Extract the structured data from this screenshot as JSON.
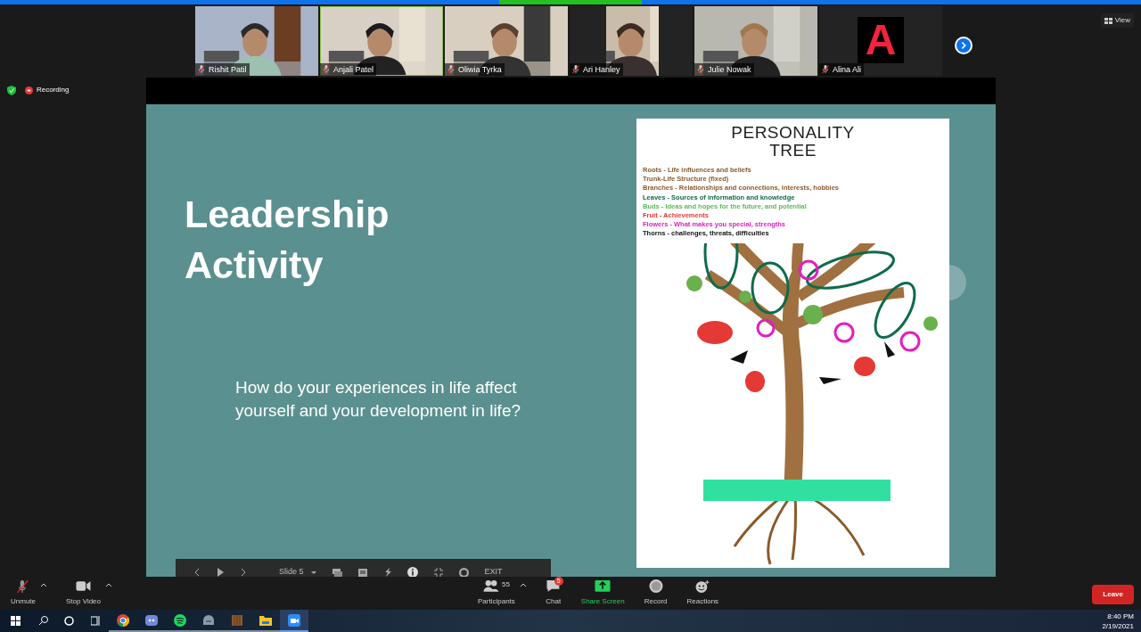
{
  "participants": [
    {
      "name": "Rishit Patil",
      "kind": "video",
      "muted": true,
      "speaking": false
    },
    {
      "name": "Anjali Patel",
      "kind": "video",
      "muted": true,
      "speaking": true
    },
    {
      "name": "Oliwia Tyrka",
      "kind": "video",
      "muted": true,
      "speaking": false
    },
    {
      "name": "Ari Hanley",
      "kind": "narrow",
      "muted": true,
      "speaking": false
    },
    {
      "name": "Julie Nowak",
      "kind": "video",
      "muted": true,
      "speaking": false
    },
    {
      "name": "Alina Ali",
      "kind": "avatar",
      "muted": true,
      "speaking": false,
      "letter": "A"
    }
  ],
  "view_button": "View",
  "recording": "Recording",
  "slide": {
    "title": "Leadership Activity",
    "question": "How do your experiences in life affect yourself and your development in life?",
    "poster_title": [
      "PERSONALITY",
      "TREE"
    ],
    "legend": [
      {
        "text": "Roots - Life influences and beliefs",
        "color": "#8a5a2b"
      },
      {
        "text": "Trunk-Life Structure (fixed)",
        "color": "#8a5a2b"
      },
      {
        "text": "Branches - Relationships and connections, interests, hobbies",
        "color": "#8a5a2b"
      },
      {
        "text": "Leaves - Sources of information and knowledge",
        "color": "#0f6b4a"
      },
      {
        "text": "Buds - Ideas and hopes for the future, and potential",
        "color": "#5cb85c"
      },
      {
        "text": "Fruit - Achievements",
        "color": "#e53935"
      },
      {
        "text": "Flowers - What makes you special, strengths",
        "color": "#e020c0"
      },
      {
        "text": "Thorns - challenges, threats, difficulties",
        "color": "#111111"
      }
    ],
    "toolbar": {
      "slide_label": "Slide 5",
      "exit": "EXIT"
    }
  },
  "controls": [
    {
      "label": "Unmute",
      "kind": "mic"
    },
    {
      "label": "Stop Video",
      "kind": "video"
    }
  ],
  "center_controls": [
    {
      "label": "Participants",
      "kind": "participants",
      "count": "55"
    },
    {
      "label": "Chat",
      "kind": "chat",
      "badge": "5"
    },
    {
      "label": "Share Screen",
      "kind": "share"
    },
    {
      "label": "Record",
      "kind": "record"
    },
    {
      "label": "Reactions",
      "kind": "reactions"
    }
  ],
  "leave": "Leave",
  "taskbar": {
    "apps": [
      {
        "kind": "chrome",
        "selected": false
      },
      {
        "kind": "discord",
        "selected": false
      },
      {
        "kind": "spotify",
        "selected": false
      },
      {
        "kind": "steam",
        "selected": false
      },
      {
        "kind": "crate",
        "selected": false
      },
      {
        "kind": "folder",
        "selected": false
      },
      {
        "kind": "zoom",
        "selected": true
      }
    ],
    "time": "8:40 PM",
    "date": "2/19/2021"
  }
}
